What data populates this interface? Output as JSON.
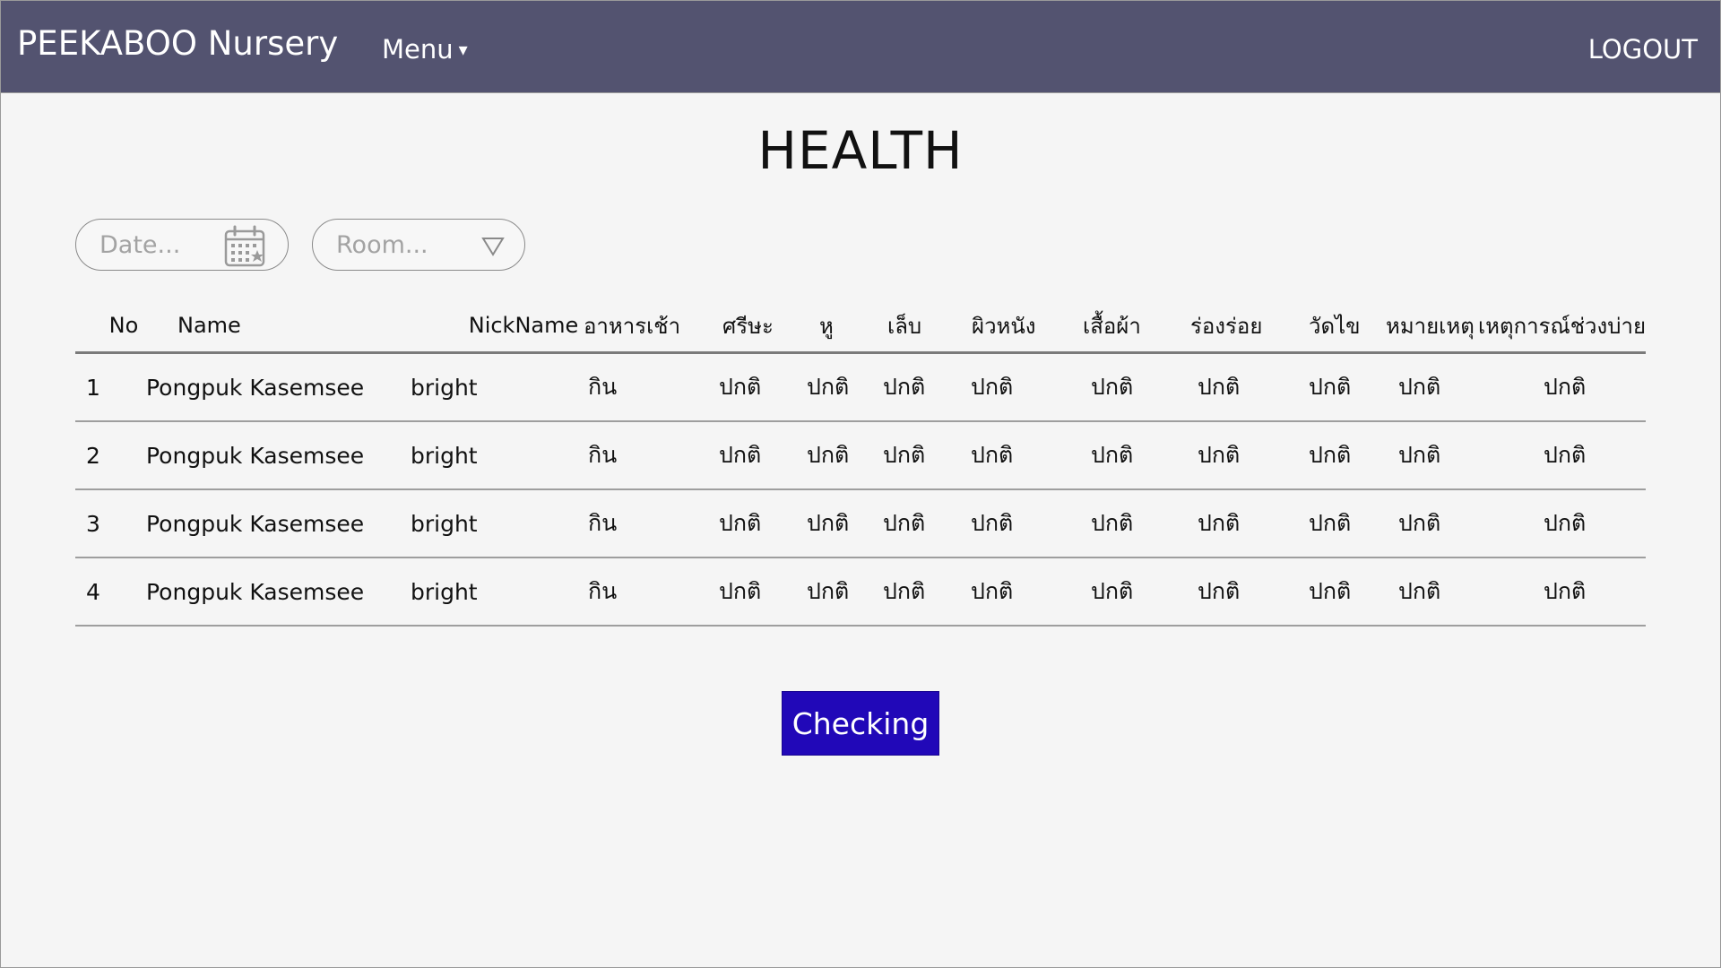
{
  "navbar": {
    "brand": "PEEKABOO Nursery",
    "menu_label": "Menu",
    "menu_caret": "▾",
    "logout_label": "LOGOUT",
    "background": "#535370"
  },
  "page": {
    "title": "HEALTH"
  },
  "filters": {
    "date_placeholder": "Date...",
    "date_icon": "calendar-icon",
    "room_placeholder": "Room...",
    "room_icon": "triangle-down-icon"
  },
  "table": {
    "columns": [
      "No",
      "Name",
      "NickName",
      "อาหารเช้า",
      "ศรีษะ",
      "หู",
      "เล็บ",
      "ผิวหนัง",
      "เสื้อผ้า",
      "ร่องร่อย",
      "วัดไข",
      "หมายเหตุ",
      "เหตุการณ์ช่วงบ่าย"
    ],
    "rows": [
      [
        "1",
        "Pongpuk Kasemsee",
        "bright",
        "กิน",
        "ปกติ",
        "ปกติ",
        "ปกติ",
        "ปกติ",
        "ปกติ",
        "ปกติ",
        "ปกติ",
        "ปกติ",
        "ปกติ"
      ],
      [
        "2",
        "Pongpuk Kasemsee",
        "bright",
        "กิน",
        "ปกติ",
        "ปกติ",
        "ปกติ",
        "ปกติ",
        "ปกติ",
        "ปกติ",
        "ปกติ",
        "ปกติ",
        "ปกติ"
      ],
      [
        "3",
        "Pongpuk Kasemsee",
        "bright",
        "กิน",
        "ปกติ",
        "ปกติ",
        "ปกติ",
        "ปกติ",
        "ปกติ",
        "ปกติ",
        "ปกติ",
        "ปกติ",
        "ปกติ"
      ],
      [
        "4",
        "Pongpuk Kasemsee",
        "bright",
        "กิน",
        "ปกติ",
        "ปกติ",
        "ปกติ",
        "ปกติ",
        "ปกติ",
        "ปกติ",
        "ปกติ",
        "ปกติ",
        "ปกติ"
      ]
    ]
  },
  "actions": {
    "checking_label": "Checking",
    "checking_color": "#2108b8"
  }
}
